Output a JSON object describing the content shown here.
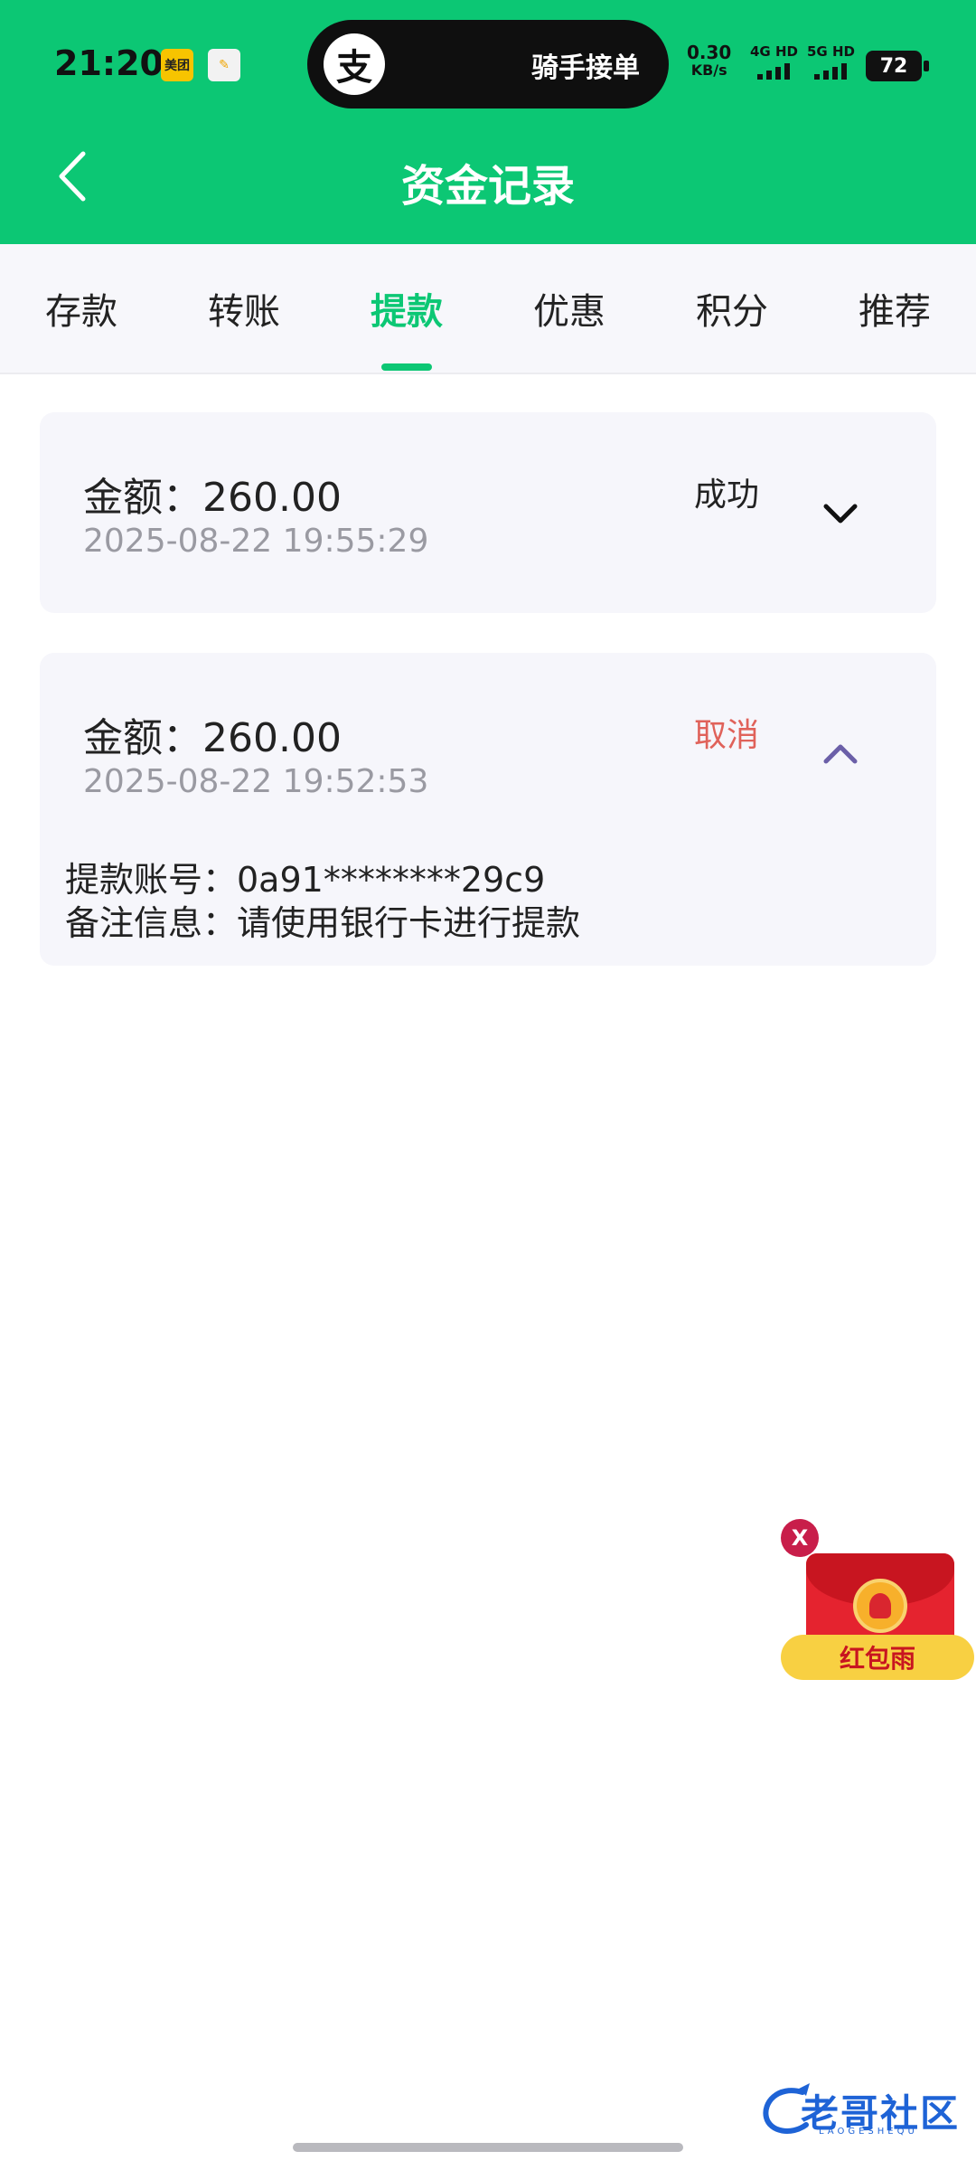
{
  "status_bar": {
    "time": "21:20",
    "app_icon_1": "美团",
    "island_text": "骑手接单",
    "island_logo": "支",
    "net_speed_value": "0.30",
    "net_speed_unit": "KB/s",
    "sim1": "4G HD",
    "sim2": "5G HD",
    "battery": "72"
  },
  "header": {
    "title": "资金记录",
    "back_icon": "chevron-left-icon"
  },
  "tabs": [
    {
      "label": "存款"
    },
    {
      "label": "转账"
    },
    {
      "label": "提款",
      "active": true
    },
    {
      "label": "优惠"
    },
    {
      "label": "积分"
    },
    {
      "label": "推荐"
    }
  ],
  "records": [
    {
      "amount": "金额：260.00",
      "datetime": "2025-08-22 19:55:29",
      "status": "成功",
      "status_color": "#222222",
      "expanded": false
    },
    {
      "amount": "金额：260.00",
      "datetime": "2025-08-22 19:52:53",
      "status": "取消",
      "status_color": "#e0625a",
      "expanded": true,
      "account": "提款账号：0a91********29c9",
      "note": "备注信息：请使用银行卡进行提款"
    }
  ],
  "red_envelope": {
    "close": "X",
    "label": "红包雨"
  },
  "watermark": {
    "text": "老哥社区",
    "sub": "LAOGESHEQU"
  },
  "colors": {
    "brand_green": "#0cc774",
    "cancel_red": "#e0625a",
    "expand_purple": "#6b5fa8"
  }
}
